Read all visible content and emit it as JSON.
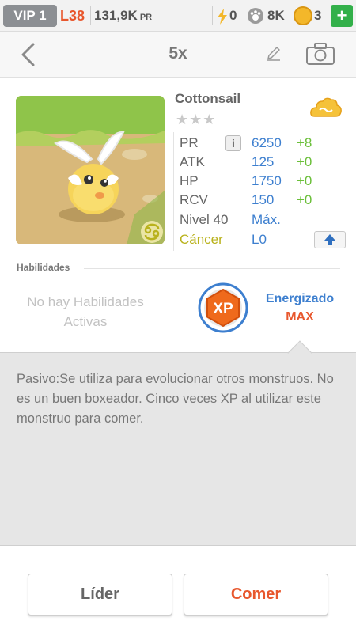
{
  "status_bar": {
    "vip": "VIP 1",
    "level": "L38",
    "power": "131,9K",
    "power_unit": "PR",
    "energy": "0",
    "energy_icon": "lightning-icon",
    "paws": "8K",
    "paws_icon": "paw-icon",
    "coins": "3",
    "coins_icon": "coin-icon",
    "add_icon": "plus-icon"
  },
  "header": {
    "count": "5x",
    "back_icon": "chevron-left-icon",
    "edit_icon": "pencil-icon",
    "camera_icon": "camera-icon"
  },
  "monster": {
    "name": "Cottonsail",
    "stars": "★★★",
    "element_icon": "cloud-icon",
    "zodiac_icon": "cancer-icon",
    "stats": [
      {
        "label": "PR",
        "value": "6250",
        "bonus": "+8"
      },
      {
        "label": "ATK",
        "value": "125",
        "bonus": "+0"
      },
      {
        "label": "HP",
        "value": "1750",
        "bonus": "+0"
      },
      {
        "label": "RCV",
        "value": "150",
        "bonus": "+0"
      }
    ],
    "level_label": "Nivel 40",
    "level_value": "Máx.",
    "sign_label": "Cáncer",
    "sign_value": "L0",
    "info_label": "i"
  },
  "abilities": {
    "title": "Habilidades",
    "none_text": "No hay Habilidades Activas",
    "badge_text": "XP",
    "energized": "Energizado",
    "max": "MAX"
  },
  "description": "Pasivo:Se utiliza para evolucionar otros monstruos. No es un buen boxeador. Cinco veces XP al utilizar este monstruo para comer.",
  "buttons": {
    "leader": "Líder",
    "eat": "Comer"
  },
  "colors": {
    "accent_orange": "#e8572d",
    "accent_blue": "#3d7fcf",
    "bonus_green": "#6bbf3a",
    "add_green": "#33b04a"
  }
}
